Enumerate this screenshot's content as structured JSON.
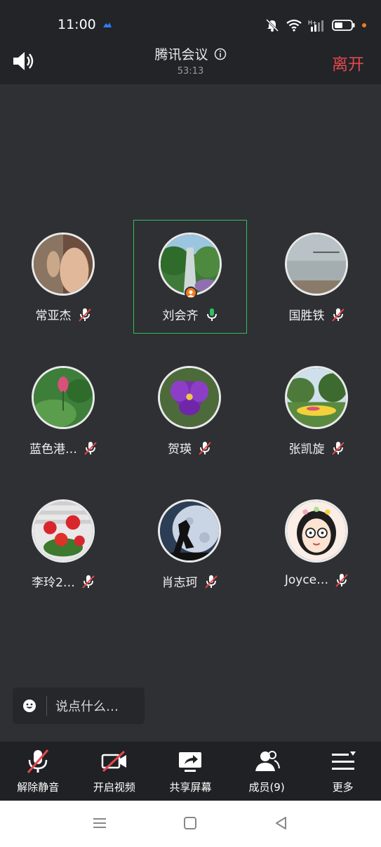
{
  "status_bar": {
    "time": "11:00",
    "icons": [
      "cloud-icon",
      "mute-bell-icon",
      "wifi-icon",
      "hplus-signal-icon",
      "battery-icon"
    ]
  },
  "header": {
    "title": "腾讯会议",
    "duration": "53:13",
    "leave_label": "离开"
  },
  "participants": [
    {
      "name": "常亚杰",
      "mic": "muted",
      "avatar": "portrait-photo"
    },
    {
      "name": "刘会齐",
      "mic": "active",
      "avatar": "waterfall-photo",
      "host": true,
      "speaking_highlight": true
    },
    {
      "name": "国胜铁",
      "mic": "muted",
      "avatar": "seascape-photo"
    },
    {
      "name": "蓝色港…",
      "mic": "muted",
      "avatar": "lotus-photo"
    },
    {
      "name": "贺瑛",
      "mic": "muted",
      "avatar": "purple-flower-photo"
    },
    {
      "name": "张凯旋",
      "mic": "muted",
      "avatar": "flower-garden-photo"
    },
    {
      "name": "李玲2…",
      "mic": "muted",
      "avatar": "red-flowers-photo"
    },
    {
      "name": "肖志珂",
      "mic": "muted",
      "avatar": "horse-moon-photo"
    },
    {
      "name": "Joyce…",
      "mic": "muted",
      "avatar": "cartoon-girl"
    }
  ],
  "chat": {
    "placeholder": "说点什么…"
  },
  "toolbar": [
    {
      "label": "解除静音",
      "icon": "mic-muted-icon"
    },
    {
      "label": "开启视频",
      "icon": "video-off-icon"
    },
    {
      "label": "共享屏幕",
      "icon": "share-screen-icon"
    },
    {
      "label": "成员(9)",
      "icon": "members-icon"
    },
    {
      "label": "更多",
      "icon": "more-menu-icon"
    }
  ],
  "colors": {
    "accent_red": "#e5484d",
    "active_green": "#2fbf5f",
    "host_orange": "#f07b1f"
  }
}
